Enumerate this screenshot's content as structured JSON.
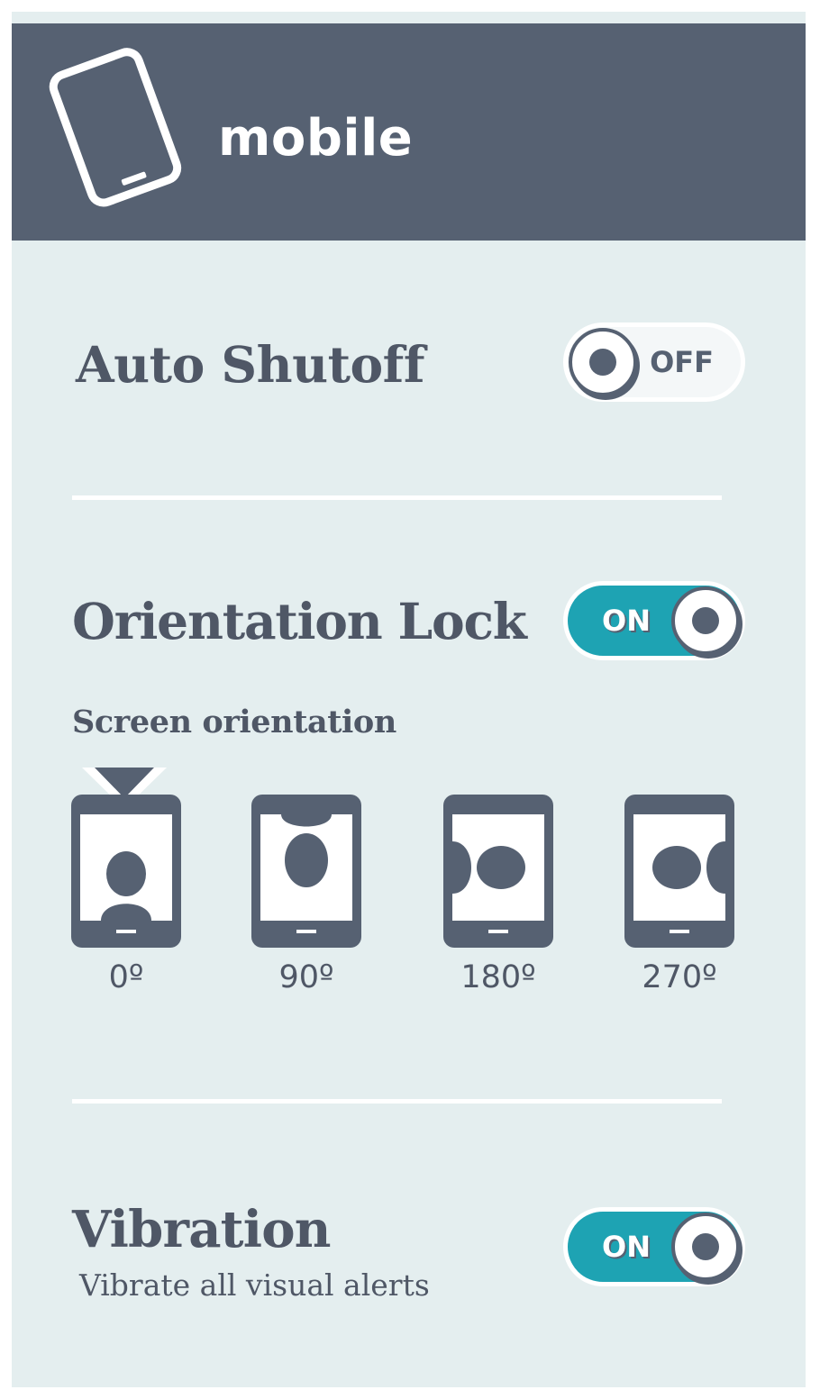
{
  "header": {
    "title": "mobile",
    "icon": "tablet-icon",
    "background": "#566172"
  },
  "auto_shutoff": {
    "label": "Auto Shutoff",
    "toggle_state": "OFF"
  },
  "orientation_lock": {
    "label": "Orientation Lock",
    "toggle_state": "ON",
    "section_label": "Screen orientation",
    "selected": "0º",
    "options": [
      {
        "label": "0º",
        "icon": "portrait-upright-icon"
      },
      {
        "label": "90º",
        "icon": "portrait-rotated-90-icon"
      },
      {
        "label": "180º",
        "icon": "portrait-rotated-180-icon"
      },
      {
        "label": "270º",
        "icon": "portrait-rotated-270-icon"
      }
    ]
  },
  "vibration": {
    "label": "Vibration",
    "description": "Vibrate all visual alerts",
    "toggle_state": "ON"
  },
  "colors": {
    "accent": "#1ea3b3",
    "slate": "#566172",
    "panel": "#e4eeef"
  }
}
